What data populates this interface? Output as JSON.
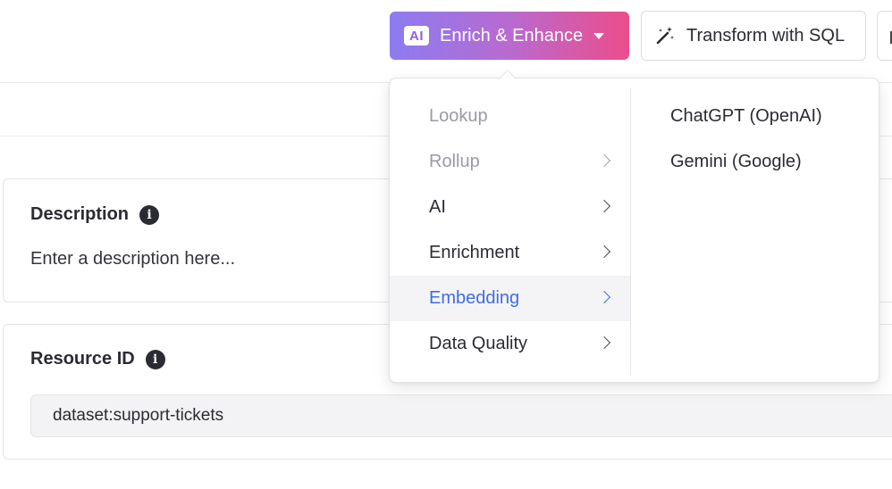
{
  "toolbar": {
    "enrich_button": {
      "badge": "AI",
      "label": "Enrich & Enhance"
    },
    "sql_button": {
      "label": "Transform with SQL"
    }
  },
  "description": {
    "title": "Description",
    "placeholder": "Enter a description here..."
  },
  "resource": {
    "title": "Resource ID",
    "value": "dataset:support-tickets"
  },
  "menu": {
    "items": [
      {
        "label": "Lookup",
        "disabled": true,
        "has_submenu": false
      },
      {
        "label": "Rollup",
        "disabled": true,
        "has_submenu": true
      },
      {
        "label": "AI",
        "disabled": false,
        "has_submenu": true
      },
      {
        "label": "Enrichment",
        "disabled": false,
        "has_submenu": true
      },
      {
        "label": "Embedding",
        "disabled": false,
        "has_submenu": true,
        "active": true
      },
      {
        "label": "Data Quality",
        "disabled": false,
        "has_submenu": true
      }
    ],
    "submenu": [
      {
        "label": "ChatGPT (OpenAI)"
      },
      {
        "label": "Gemini (Google)"
      }
    ]
  },
  "colors": {
    "gradient_start": "#8b7cf0",
    "gradient_end": "#ec4d8a",
    "active_item": "#3d6ee6"
  }
}
